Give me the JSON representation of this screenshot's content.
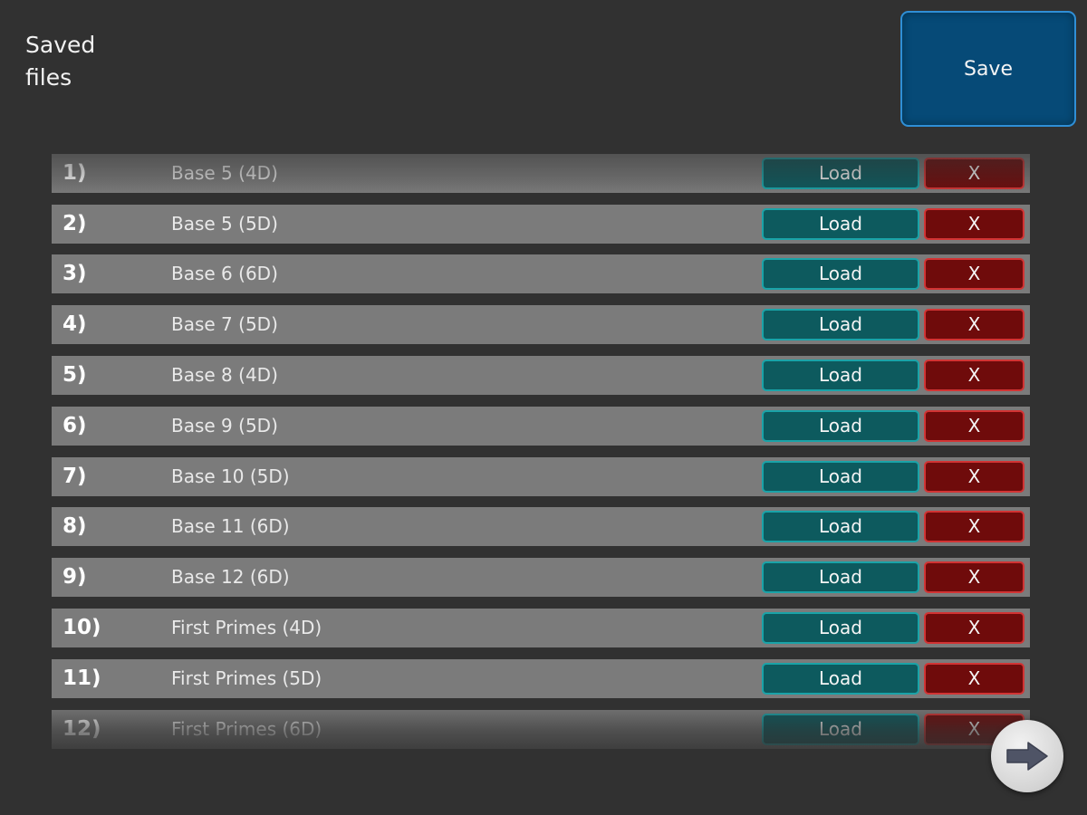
{
  "header": {
    "title": "Saved\nfiles",
    "save_label": "Save"
  },
  "files": [
    {
      "index": "1)",
      "name": "Base 5 (4D)",
      "load_label": "Load",
      "delete_label": "X"
    },
    {
      "index": "2)",
      "name": "Base 5 (5D)",
      "load_label": "Load",
      "delete_label": "X"
    },
    {
      "index": "3)",
      "name": "Base 6 (6D)",
      "load_label": "Load",
      "delete_label": "X"
    },
    {
      "index": "4)",
      "name": "Base 7 (5D)",
      "load_label": "Load",
      "delete_label": "X"
    },
    {
      "index": "5)",
      "name": "Base 8 (4D)",
      "load_label": "Load",
      "delete_label": "X"
    },
    {
      "index": "6)",
      "name": "Base 9 (5D)",
      "load_label": "Load",
      "delete_label": "X"
    },
    {
      "index": "7)",
      "name": "Base 10 (5D)",
      "load_label": "Load",
      "delete_label": "X"
    },
    {
      "index": "8)",
      "name": "Base 11 (6D)",
      "load_label": "Load",
      "delete_label": "X"
    },
    {
      "index": "9)",
      "name": "Base 12 (6D)",
      "load_label": "Load",
      "delete_label": "X"
    },
    {
      "index": "10)",
      "name": "First Primes (4D)",
      "load_label": "Load",
      "delete_label": "X"
    },
    {
      "index": "11)",
      "name": "First Primes (5D)",
      "load_label": "Load",
      "delete_label": "X"
    },
    {
      "index": "12)",
      "name": "First Primes (6D)",
      "load_label": "Load",
      "delete_label": "X"
    }
  ],
  "navigation": {
    "next_icon": "arrow-right-icon"
  },
  "colors": {
    "background": "#313131",
    "row": "#7b7b7b",
    "save_button": "#064a77",
    "load_button": "#0d5a5e",
    "delete_button": "#6f0b0b"
  }
}
